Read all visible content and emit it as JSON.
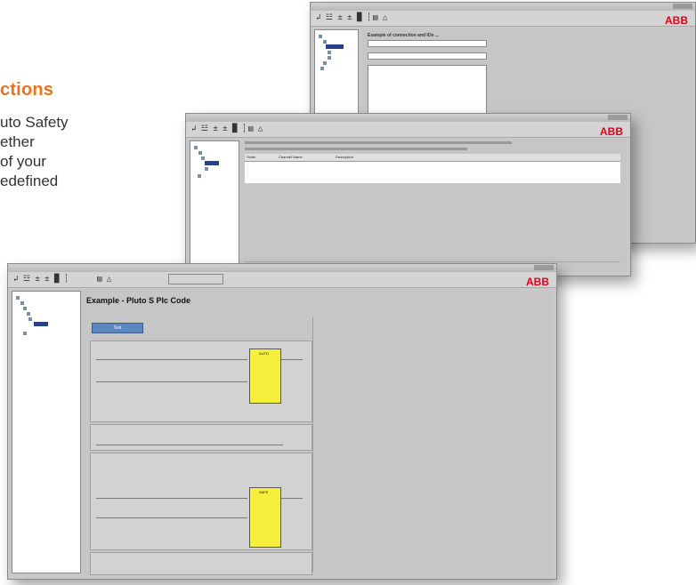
{
  "text": {
    "heading": "ctions",
    "line1": "uto Safety",
    "line2": "ether",
    "line3": "of your",
    "line4": "edefined"
  },
  "brand": {
    "logo": "ABB",
    "color": "#e2001a"
  },
  "accent": "#e8731c",
  "toolbar": {
    "left": "↲ ☳ ± ± █ ┆",
    "mid": "▤ △"
  },
  "win1": {
    "header": "Example of connection and IOs ..."
  },
  "win2": {
    "column_headers": [
      "Order",
      "Channel Name",
      "Description"
    ]
  },
  "win3": {
    "title": "Example - Pluto S PIc Code",
    "button": "Test",
    "block1": "AUTO",
    "block2": "SAFE"
  }
}
